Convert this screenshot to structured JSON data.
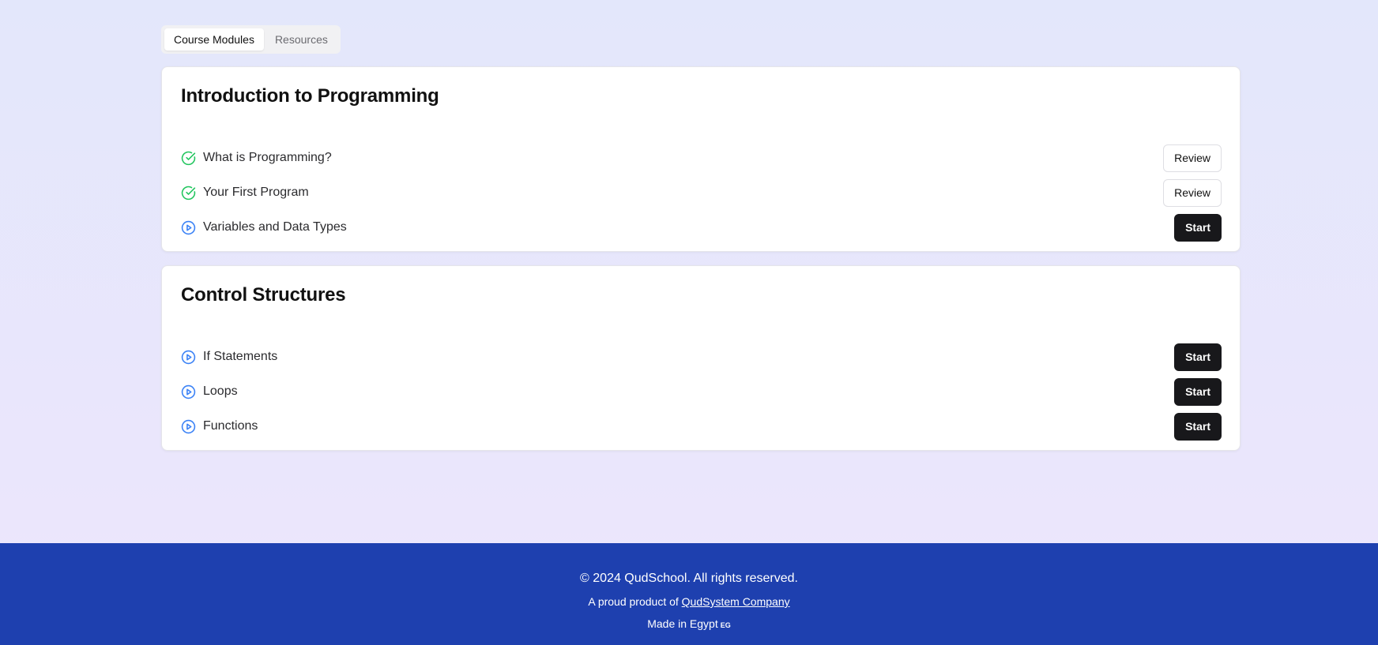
{
  "tabs": [
    {
      "label": "Course Modules",
      "active": true
    },
    {
      "label": "Resources",
      "active": false
    }
  ],
  "modules": [
    {
      "title": "Introduction to Programming",
      "lessons": [
        {
          "title": "What is Programming?",
          "status": "completed",
          "icon": "check-circle-icon",
          "action": "Review"
        },
        {
          "title": "Your First Program",
          "status": "completed",
          "icon": "check-circle-icon",
          "action": "Review"
        },
        {
          "title": "Variables and Data Types",
          "status": "not-started",
          "icon": "play-circle-icon",
          "action": "Start"
        }
      ]
    },
    {
      "title": "Control Structures",
      "lessons": [
        {
          "title": "If Statements",
          "status": "not-started",
          "icon": "play-circle-icon",
          "action": "Start"
        },
        {
          "title": "Loops",
          "status": "not-started",
          "icon": "play-circle-icon",
          "action": "Start"
        },
        {
          "title": "Functions",
          "status": "not-started",
          "icon": "play-circle-icon",
          "action": "Start"
        }
      ]
    }
  ],
  "footer": {
    "copyright": "© 2024 QudSchool. All rights reserved.",
    "proud_prefix": "A proud product of",
    "company_link": "QudSystem Company",
    "made_in": "Made in Egypt",
    "flag": "EG"
  },
  "colors": {
    "completed_icon": "#22c55e",
    "start_icon": "#3b82f6",
    "footer_bg": "#1e40af",
    "start_button": "#18181b"
  }
}
